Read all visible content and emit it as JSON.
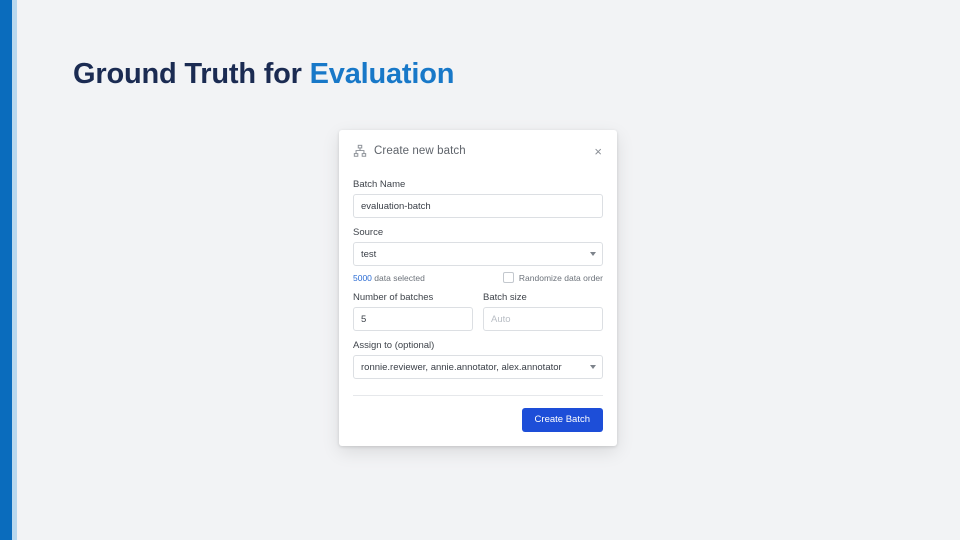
{
  "slide": {
    "title_dark": "Ground Truth for ",
    "title_accent": "Evaluation",
    "accent_bar_color": "#0a6cbd",
    "accent_bar_secondary_color": "#b8d8ef",
    "background_color": "#f2f3f5",
    "title_dark_color": "#1b2b52",
    "title_accent_color": "#1878c8"
  },
  "dialog": {
    "icon": "sitemap-icon",
    "title": "Create new batch",
    "close_label": "×",
    "fields": {
      "batch_name": {
        "label": "Batch Name",
        "value": "evaluation-batch",
        "placeholder": ""
      },
      "source": {
        "label": "Source",
        "value": "test"
      },
      "data_selected": {
        "count": "5000",
        "suffix": " data selected",
        "count_color": "#2b6cd4"
      },
      "randomize": {
        "label": "Randomize data order",
        "checked": false
      },
      "number_of_batches": {
        "label": "Number of batches",
        "value": "5",
        "placeholder": ""
      },
      "batch_size": {
        "label": "Batch size",
        "value": "",
        "placeholder": "Auto"
      },
      "assign_to": {
        "label": "Assign to (optional)",
        "value": "ronnie.reviewer, annie.annotator, alex.annotator"
      }
    },
    "footer": {
      "submit_label": "Create Batch",
      "submit_color": "#1d4ed8"
    }
  }
}
